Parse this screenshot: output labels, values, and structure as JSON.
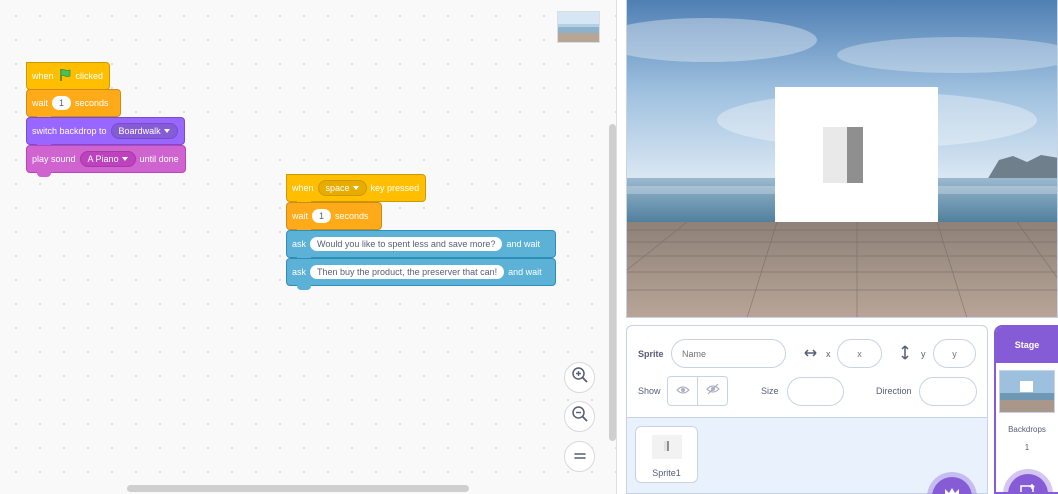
{
  "scripts": {
    "script1": {
      "when_label": "when",
      "clicked_label": "clicked",
      "wait_label": "wait",
      "wait_value": "1",
      "seconds_label": "seconds",
      "switch_label": "switch backdrop to",
      "backdrop_value": "Boardwalk",
      "play_label": "play sound",
      "sound_value": "A Piano",
      "until_label": "until done"
    },
    "script2": {
      "when_label": "when",
      "key_value": "space",
      "key_pressed_label": "key pressed",
      "wait_label": "wait",
      "wait_value": "1",
      "seconds_label": "seconds",
      "ask_label": "ask",
      "ask1_value": "Would you like to spent less and save more?",
      "and_wait_label": "and wait",
      "ask2_value": "Then buy the product, the preserver that can!"
    }
  },
  "sprite_info": {
    "sprite_label": "Sprite",
    "name_placeholder": "Name",
    "x_label": "x",
    "x_placeholder": "x",
    "y_label": "y",
    "y_placeholder": "y",
    "show_label": "Show",
    "size_label": "Size",
    "direction_label": "Direction"
  },
  "sprites": [
    {
      "name": "Sprite1"
    }
  ],
  "stage_pane": {
    "title": "Stage",
    "backdrops_label": "Backdrops",
    "backdrops_count": "1"
  },
  "colors": {
    "events": "#ffbf00",
    "control": "#ffab19",
    "looks": "#9966ff",
    "sound": "#cf63cf",
    "sensing": "#5cb1d6",
    "accent": "#855cd6"
  },
  "icons": [
    "green-flag-icon",
    "zoom-in-icon",
    "zoom-out-icon",
    "zoom-reset-icon",
    "horizontal-arrows-icon",
    "vertical-arrows-icon",
    "eye-icon",
    "eye-hidden-icon",
    "choose-sprite-icon",
    "choose-backdrop-icon"
  ]
}
